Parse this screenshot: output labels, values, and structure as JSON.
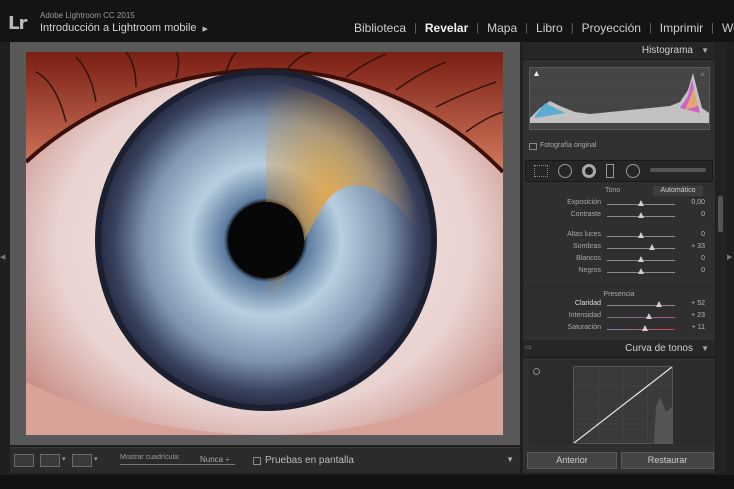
{
  "app": {
    "logo": "Lr",
    "product": "Adobe Lightroom CC 2015",
    "catalog": "Introducción a Lightroom mobile",
    "catalog_arrow": "▶"
  },
  "modules": [
    {
      "label": "Biblioteca",
      "active": false
    },
    {
      "label": "Revelar",
      "active": true
    },
    {
      "label": "Mapa",
      "active": false
    },
    {
      "label": "Libro",
      "active": false
    },
    {
      "label": "Proyección",
      "active": false
    },
    {
      "label": "Imprimir",
      "active": false
    },
    {
      "label": "Web",
      "active": false
    }
  ],
  "histogram": {
    "title": "Histograma",
    "original_label": "Fotografía original"
  },
  "basic": {
    "tone_label": "Tono",
    "auto_label": "Automático",
    "presence_label": "Presencia",
    "sliders": [
      {
        "label": "Exposición",
        "value": "0,00",
        "fraction": 0.5,
        "highlight": false
      },
      {
        "label": "Contraste",
        "value": "0",
        "fraction": 0.5,
        "highlight": false
      },
      {
        "label": "Altas luces",
        "value": "0",
        "fraction": 0.5,
        "highlight": false
      },
      {
        "label": "Sombras",
        "value": "+ 33",
        "fraction": 0.665,
        "highlight": false
      },
      {
        "label": "Blancos",
        "value": "0",
        "fraction": 0.5,
        "highlight": false
      },
      {
        "label": "Negros",
        "value": "0",
        "fraction": 0.5,
        "highlight": false
      },
      {
        "label": "Claridad",
        "value": "+ 52",
        "fraction": 0.76,
        "highlight": true
      },
      {
        "label": "Intensidad",
        "value": "+ 23",
        "fraction": 0.615,
        "highlight": false
      },
      {
        "label": "Saturación",
        "value": "+ 11",
        "fraction": 0.555,
        "highlight": false
      }
    ]
  },
  "curve": {
    "title": "Curva de tonos"
  },
  "buttons": {
    "previous": "Anterior",
    "reset": "Restaurar"
  },
  "toolbar": {
    "grid_label": "Mostrar cuadrícula:",
    "grid_value": "Nunca ÷",
    "proof_label": "Pruebas en pantalla"
  },
  "colors": {
    "accent": "#f2f2f2",
    "panel": "#303030",
    "background": "#1f1f1f"
  }
}
